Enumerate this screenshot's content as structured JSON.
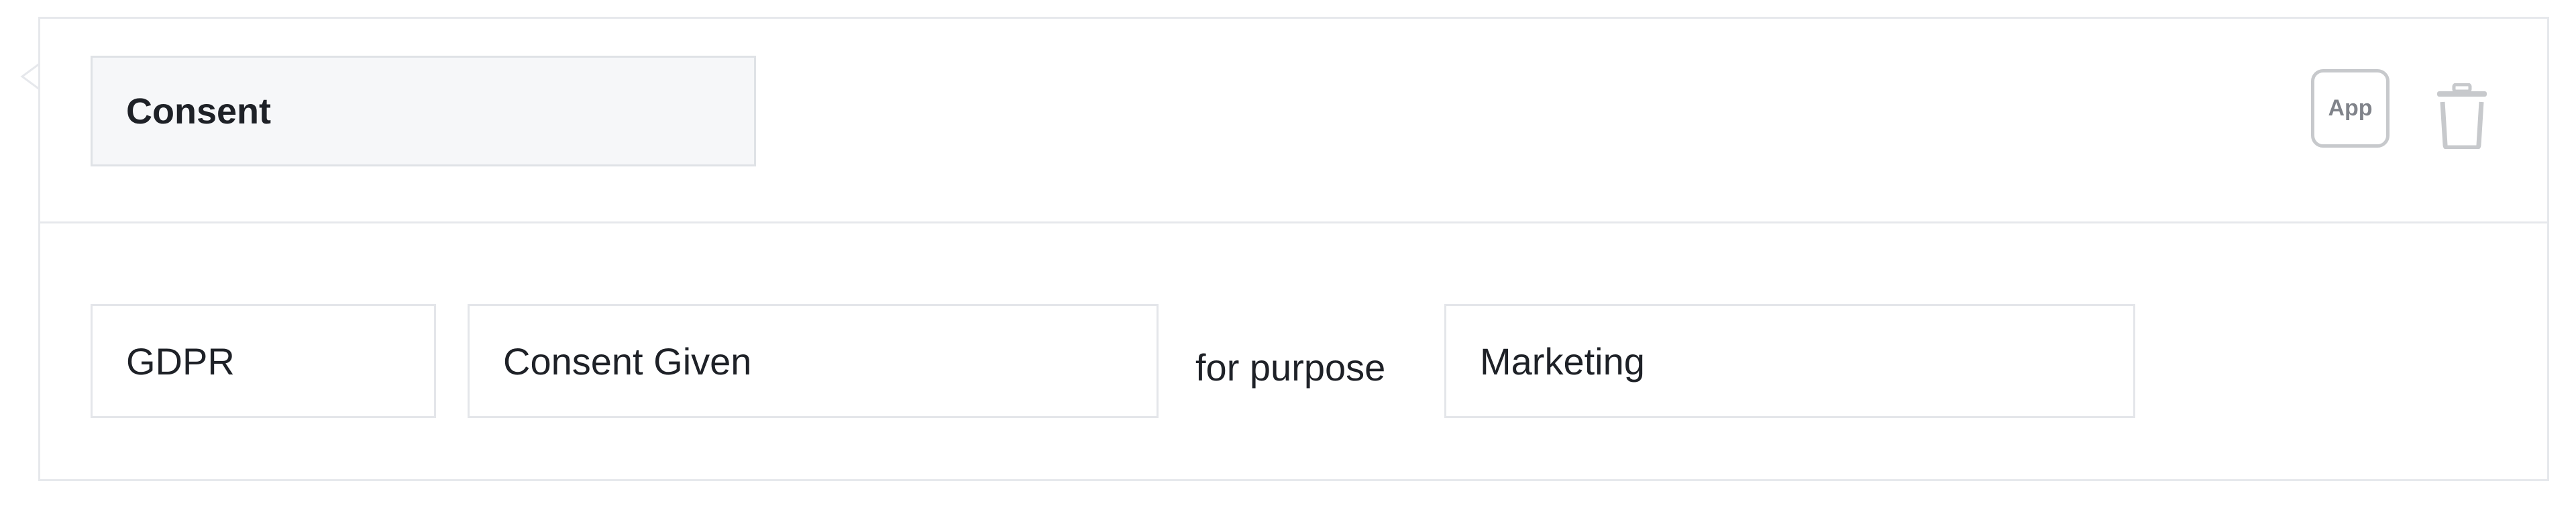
{
  "rule": {
    "title": "Consent",
    "actions": {
      "app_label": "App",
      "delete_icon": "trash-icon"
    },
    "condition": {
      "regulation": "GDPR",
      "status": "Consent Given",
      "connector": "for purpose",
      "purpose": "Marketing"
    }
  },
  "colors": {
    "border": "#e6e8ec",
    "title_background": "#f6f7f9",
    "text": "#1e2127",
    "icon_gray": "#c7c9cc"
  }
}
